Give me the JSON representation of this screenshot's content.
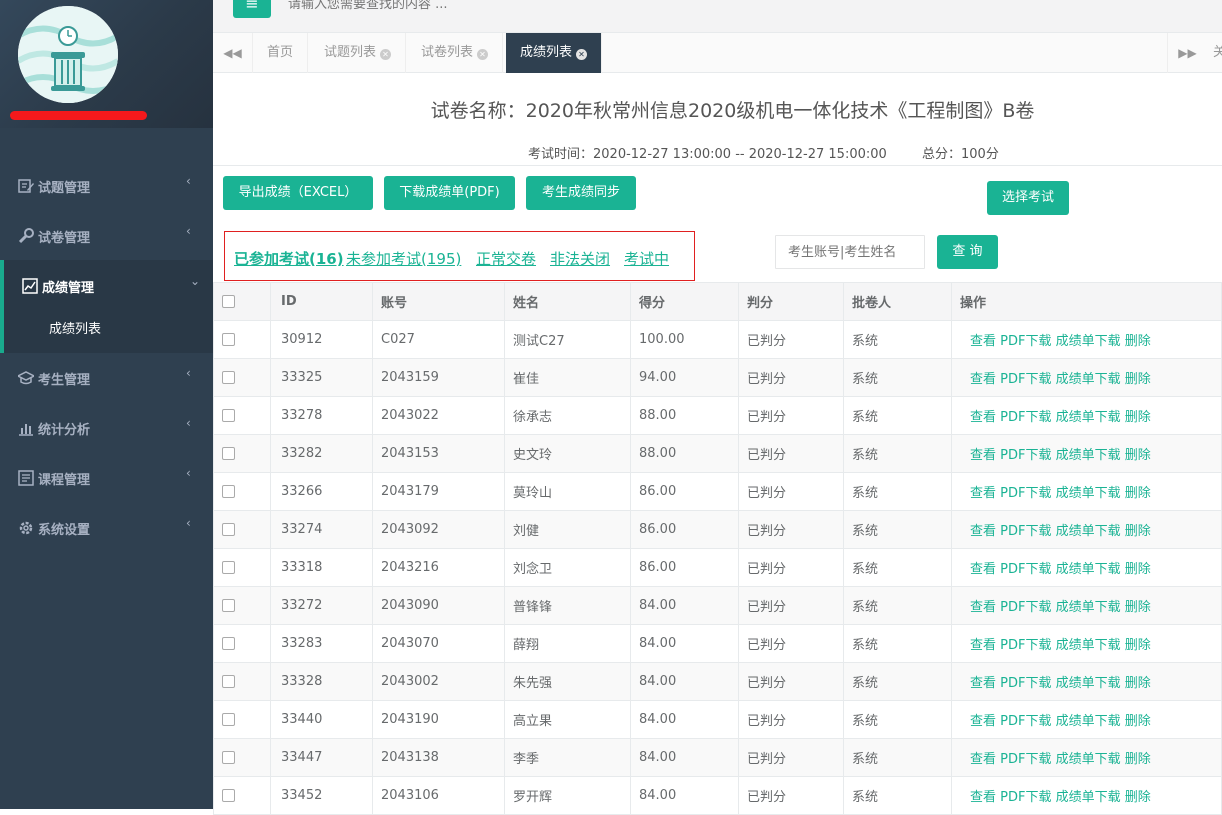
{
  "topbar": {
    "menu_icon": "bars-icon",
    "search_placeholder": "请输入您需要查找的内容 ..."
  },
  "sidebar": {
    "items": [
      {
        "label": "试题管理",
        "icon": "edit-icon"
      },
      {
        "label": "试卷管理",
        "icon": "wrench-icon"
      },
      {
        "label": "成绩管理",
        "icon": "chart-box-icon"
      },
      {
        "label": "考生管理",
        "icon": "graduation-cap-icon"
      },
      {
        "label": "统计分析",
        "icon": "bar-chart-icon"
      },
      {
        "label": "课程管理",
        "icon": "list-icon"
      },
      {
        "label": "系统设置",
        "icon": "gear-icon"
      }
    ],
    "sub_item": "成绩列表"
  },
  "tabs": [
    {
      "label": "首页"
    },
    {
      "label": "试题列表"
    },
    {
      "label": "试卷列表"
    },
    {
      "label": "成绩列表"
    }
  ],
  "tab_close_label": "关",
  "exam": {
    "title": "试卷名称：2020年秋常州信息2020级机电一体化技术《工程制图》B卷",
    "time": "考试时间：2020-12-27 13:00:00 -- 2020-12-27 15:00:00",
    "score": "总分：100分"
  },
  "buttons": {
    "export_excel": "导出成绩（EXCEL）",
    "download_pdf": "下载成绩单(PDF)",
    "sync": "考生成绩同步",
    "select_exam": "选择考试",
    "query": "查 询"
  },
  "filters": {
    "joined": "已参加考试(16)",
    "not_joined": "未参加考试(195)",
    "normal": "正常交卷",
    "illegal": "非法关闭",
    "testing": "考试中"
  },
  "search_placeholder": "考生账号|考生姓名",
  "table": {
    "headers": [
      "ID",
      "账号",
      "姓名",
      "得分",
      "判分",
      "批卷人",
      "操作"
    ],
    "rows": [
      [
        "30912",
        "C027",
        "测试C27",
        "100.00",
        "已判分",
        "系统"
      ],
      [
        "33325",
        "2043159",
        "崔佳",
        "94.00",
        "已判分",
        "系统"
      ],
      [
        "33278",
        "2043022",
        "徐承志",
        "88.00",
        "已判分",
        "系统"
      ],
      [
        "33282",
        "2043153",
        "史文玲",
        "88.00",
        "已判分",
        "系统"
      ],
      [
        "33266",
        "2043179",
        "莫玲山",
        "86.00",
        "已判分",
        "系统"
      ],
      [
        "33274",
        "2043092",
        "刘健",
        "86.00",
        "已判分",
        "系统"
      ],
      [
        "33318",
        "2043216",
        "刘念卫",
        "86.00",
        "已判分",
        "系统"
      ],
      [
        "33272",
        "2043090",
        "普锋锋",
        "84.00",
        "已判分",
        "系统"
      ],
      [
        "33283",
        "2043070",
        "薛翔",
        "84.00",
        "已判分",
        "系统"
      ],
      [
        "33328",
        "2043002",
        "朱先强",
        "84.00",
        "已判分",
        "系统"
      ],
      [
        "33440",
        "2043190",
        "高立果",
        "84.00",
        "已判分",
        "系统"
      ],
      [
        "33447",
        "2043138",
        "李季",
        "84.00",
        "已判分",
        "系统"
      ],
      [
        "33452",
        "2043106",
        "罗开辉",
        "84.00",
        "已判分",
        "系统"
      ]
    ],
    "ops": [
      "查看",
      "PDF下载",
      "成绩单下载",
      "删除"
    ]
  },
  "colors": {
    "accent": "#1ab394",
    "sidebar": "#2f4050",
    "alert": "#e02020"
  }
}
